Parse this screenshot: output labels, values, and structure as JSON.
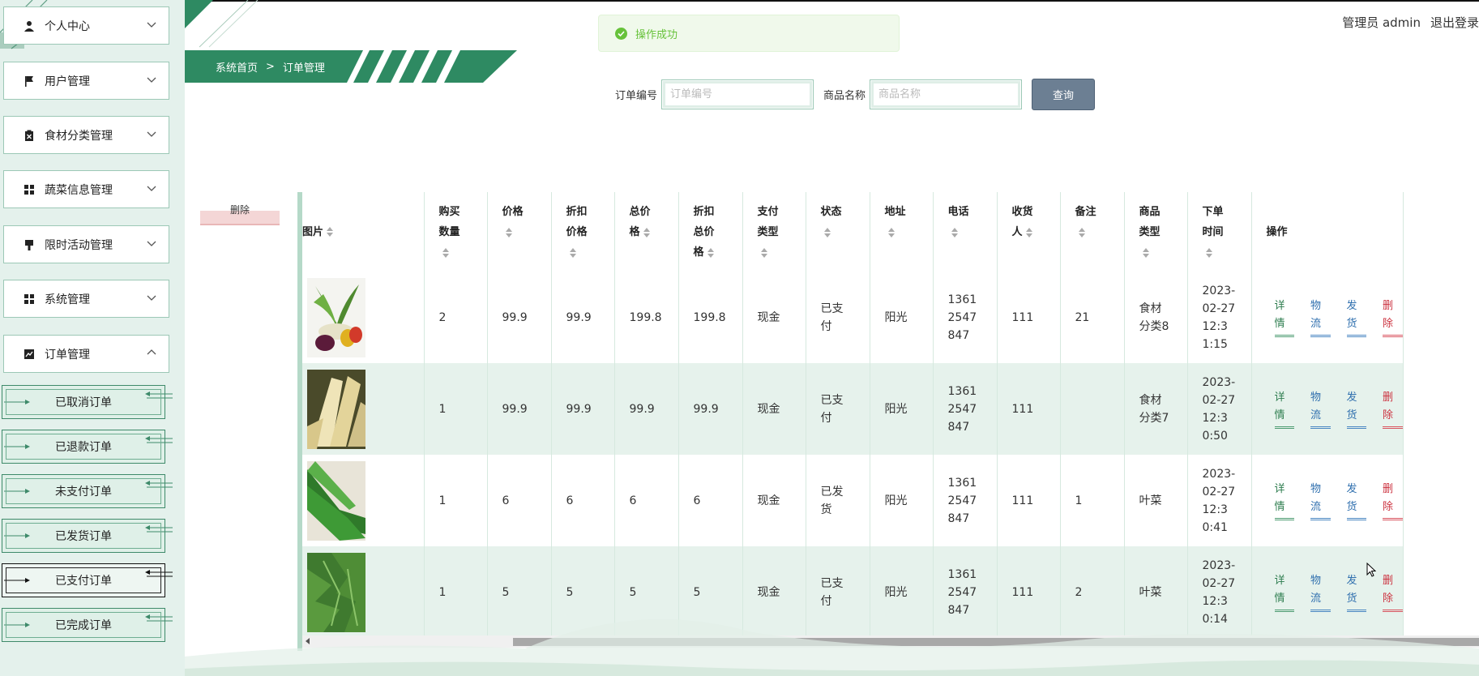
{
  "header": {
    "breadcrumb": {
      "home": "系统首页",
      "separator": ">",
      "current": "订单管理"
    },
    "user": {
      "role_name": "管理员 admin",
      "logout_label": "退出登录"
    }
  },
  "toast": {
    "message": "操作成功",
    "icon": "check-circle-icon",
    "color": "#67c23a"
  },
  "sidebar": {
    "menus": [
      {
        "label": "个人中心",
        "icon": "user-icon",
        "expanded": false
      },
      {
        "label": "用户管理",
        "icon": "flag-icon",
        "expanded": false
      },
      {
        "label": "食材分类管理",
        "icon": "clipboard-x-icon",
        "expanded": false
      },
      {
        "label": "蔬菜信息管理",
        "icon": "grid-icon",
        "expanded": false
      },
      {
        "label": "限时活动管理",
        "icon": "pin-icon",
        "expanded": false
      },
      {
        "label": "系统管理",
        "icon": "grid-icon",
        "expanded": false
      },
      {
        "label": "订单管理",
        "icon": "chart-icon",
        "expanded": true
      }
    ],
    "submenu": [
      {
        "label": "已取消订单",
        "active": false
      },
      {
        "label": "已退款订单",
        "active": false
      },
      {
        "label": "未支付订单",
        "active": false
      },
      {
        "label": "已发货订单",
        "active": false
      },
      {
        "label": "已支付订单",
        "active": true
      },
      {
        "label": "已完成订单",
        "active": false
      }
    ]
  },
  "search": {
    "order_no_label": "订单编号",
    "order_no_placeholder": "订单编号",
    "product_label": "商品名称",
    "product_placeholder": "商品名称",
    "query_label": "查询"
  },
  "toolbar": {
    "delete_label": "删除"
  },
  "table": {
    "columns": [
      {
        "line1": "图片",
        "line2": ""
      },
      {
        "line1": "购买",
        "line2": "数量"
      },
      {
        "line1": "价格",
        "line2": ""
      },
      {
        "line1": "折扣",
        "line2": "价格"
      },
      {
        "line1": "总价",
        "line2": "格"
      },
      {
        "line1": "折扣",
        "line2": "总价",
        "line3": "格"
      },
      {
        "line1": "支付",
        "line2": "类型"
      },
      {
        "line1": "状态",
        "line2": ""
      },
      {
        "line1": "地址",
        "line2": ""
      },
      {
        "line1": "电话",
        "line2": ""
      },
      {
        "line1": "收货",
        "line2": "人"
      },
      {
        "line1": "备注",
        "line2": ""
      },
      {
        "line1": "商品",
        "line2": "类型"
      },
      {
        "line1": "下单",
        "line2": "时间"
      },
      {
        "line1": "操作",
        "line2": ""
      }
    ],
    "rows": [
      {
        "qty": "2",
        "price": "99.9",
        "disc_price": "99.9",
        "total": "199.8",
        "disc_total": "199.8",
        "pay_type": "现金",
        "status_1": "已支",
        "status_2": "付",
        "address": "阳光",
        "phone_1": "1361",
        "phone_2": "2547",
        "phone_3": "847",
        "receiver": "111",
        "note": "21",
        "type_1": "食材",
        "type_2": "分类8",
        "time_1": "2023-",
        "time_2": "02-27",
        "time_3": "12:3",
        "time_4": "1:15",
        "image": "vegetable-basket-photo"
      },
      {
        "qty": "1",
        "price": "99.9",
        "disc_price": "99.9",
        "total": "99.9",
        "disc_total": "99.9",
        "pay_type": "现金",
        "status_1": "已支",
        "status_2": "付",
        "address": "阳光",
        "phone_1": "1361",
        "phone_2": "2547",
        "phone_3": "847",
        "receiver": "111",
        "note": "",
        "type_1": "食材",
        "type_2": "分类7",
        "time_1": "2023-",
        "time_2": "02-27",
        "time_3": "12:3",
        "time_4": "0:50",
        "image": "bamboo-shoot-photo"
      },
      {
        "qty": "1",
        "price": "6",
        "disc_price": "6",
        "total": "6",
        "disc_total": "6",
        "pay_type": "现金",
        "status_1": "已发",
        "status_2": "货",
        "address": "阳光",
        "phone_1": "1361",
        "phone_2": "2547",
        "phone_3": "847",
        "receiver": "111",
        "note": "1",
        "type_1": "叶菜",
        "type_2": "",
        "time_1": "2023-",
        "time_2": "02-27",
        "time_3": "12:3",
        "time_4": "0:41",
        "image": "chive-photo"
      },
      {
        "qty": "1",
        "price": "5",
        "disc_price": "5",
        "total": "5",
        "disc_total": "5",
        "pay_type": "现金",
        "status_1": "已支",
        "status_2": "付",
        "address": "阳光",
        "phone_1": "1361",
        "phone_2": "2547",
        "phone_3": "847",
        "receiver": "111",
        "note": "2",
        "type_1": "叶菜",
        "type_2": "",
        "time_1": "2023-",
        "time_2": "02-27",
        "time_3": "12:3",
        "time_4": "0:14",
        "image": "arugula-photo"
      }
    ],
    "actions": {
      "detail": "详情",
      "logistics": "物流",
      "ship": "发货",
      "delete": "删除"
    }
  },
  "colors": {
    "brand_green": "#2e8a62",
    "sidebar_bg": "#e4f1ec",
    "row_alt": "#e6f2ec",
    "danger": "#cc3340",
    "link_blue": "#2f6fae"
  }
}
